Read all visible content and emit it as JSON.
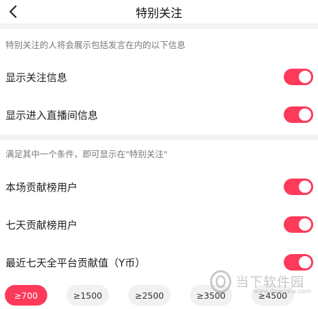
{
  "header": {
    "back_icon": "chevron-left-icon",
    "title": "特别关注"
  },
  "section1": {
    "note": "特别关注的人将会展示包括发言在内的以下信息",
    "rows": [
      {
        "label": "显示关注信息",
        "enabled": true
      },
      {
        "label": "显示进入直播间信息",
        "enabled": true
      }
    ]
  },
  "section2": {
    "note": "满足其中一个条件，即可显示在\"特别关注\"",
    "rows": [
      {
        "label": "本场贡献榜用户",
        "enabled": true
      },
      {
        "label": "七天贡献榜用户",
        "enabled": true
      },
      {
        "label": "最近七天全平台贡献值（Y币）",
        "enabled": true
      }
    ]
  },
  "thresholds": {
    "options": [
      "≥700",
      "≥1500",
      "≥2500",
      "≥3500",
      "≥4500"
    ],
    "selected": "≥700"
  },
  "watermark": {
    "name": "当下软件园",
    "url": "www.downxia.com"
  },
  "colors": {
    "accent": "#fd3a5a",
    "chip_bg": "#f1f1f1",
    "band_bg": "#f3f3f3"
  }
}
